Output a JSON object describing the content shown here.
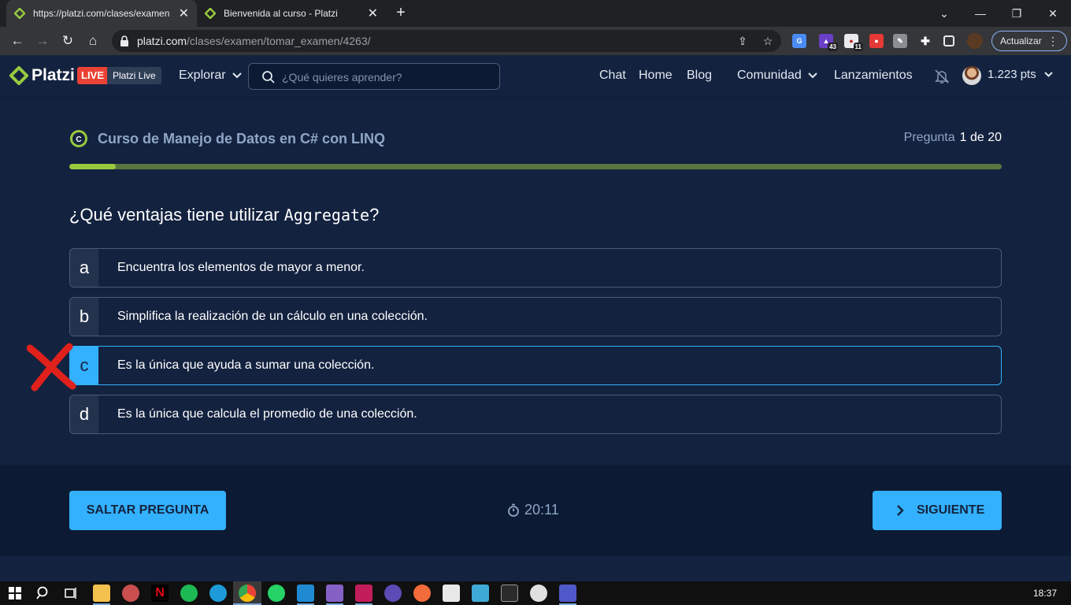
{
  "browser": {
    "tabs": [
      {
        "title": "https://platzi.com/clases/examen",
        "active": true
      },
      {
        "title": "Bienvenida al curso - Platzi",
        "active": false
      }
    ],
    "url_host": "platzi.com",
    "url_path": "/clases/examen/tomar_examen/4263/",
    "update_label": "Actualizar",
    "extensions": [
      {
        "icon": "translate-icon",
        "color": "#4a8af4",
        "badge": ""
      },
      {
        "icon": "hat-extension-icon",
        "color": "#6a3fc7",
        "badge": "43"
      },
      {
        "icon": "pomodoro-extension-icon",
        "color": "#e8eaed",
        "badge": "11"
      },
      {
        "icon": "record-extension-icon",
        "color": "#e53935",
        "badge": ""
      },
      {
        "icon": "edit-extension-icon",
        "color": "#8a8d91",
        "badge": ""
      }
    ]
  },
  "header": {
    "logo_text": "Platzi",
    "live_badge": "LIVE",
    "live_name": "Platzi Live",
    "explorar": "Explorar",
    "search_placeholder": "¿Qué quieres aprender?",
    "nav": [
      "Chat",
      "Home",
      "Blog"
    ],
    "comunidad": "Comunidad",
    "lanzamientos": "Lanzamientos",
    "points": "1.223 pts"
  },
  "exam": {
    "course_title": "Curso de Manejo de Datos en C# con LINQ",
    "counter_label": "Pregunta",
    "counter_value": "1 de 20",
    "progress_fraction": 0.05,
    "question_prefix": "¿Qué ventajas tiene utilizar ",
    "question_code": "Aggregate",
    "question_suffix": "?",
    "options": [
      {
        "letter": "a",
        "text": "Encuentra los elementos de mayor a menor."
      },
      {
        "letter": "b",
        "text": "Simplifica la realización de un cálculo en una colección."
      },
      {
        "letter": "c",
        "text": "Es la única que ayuda a sumar una colección.",
        "selected": true
      },
      {
        "letter": "d",
        "text": "Es la única que calcula el promedio de una colección."
      }
    ]
  },
  "footer": {
    "skip_label": "SALTAR PREGUNTA",
    "timer": "20:11",
    "next_label": "SIGUIENTE"
  },
  "taskbar": {
    "clock": "18:37",
    "apps": [
      "start-icon",
      "search-icon",
      "task-view-icon",
      "file-explorer-icon",
      "paint-icon",
      "netflix-icon",
      "spotify-icon",
      "edge-icon",
      "chrome-icon",
      "whatsapp-icon",
      "vscode-icon",
      "visual-studio-icon",
      "rider-icon",
      "app-icon",
      "app-icon-2",
      "app-icon-3",
      "app-icon-4",
      "terminal-icon",
      "app-icon-5",
      "teams-icon"
    ]
  },
  "colors": {
    "accent": "#33b1ff",
    "progress_fill": "#98ca3f",
    "progress_track": "#57773e",
    "background": "#13223f"
  }
}
